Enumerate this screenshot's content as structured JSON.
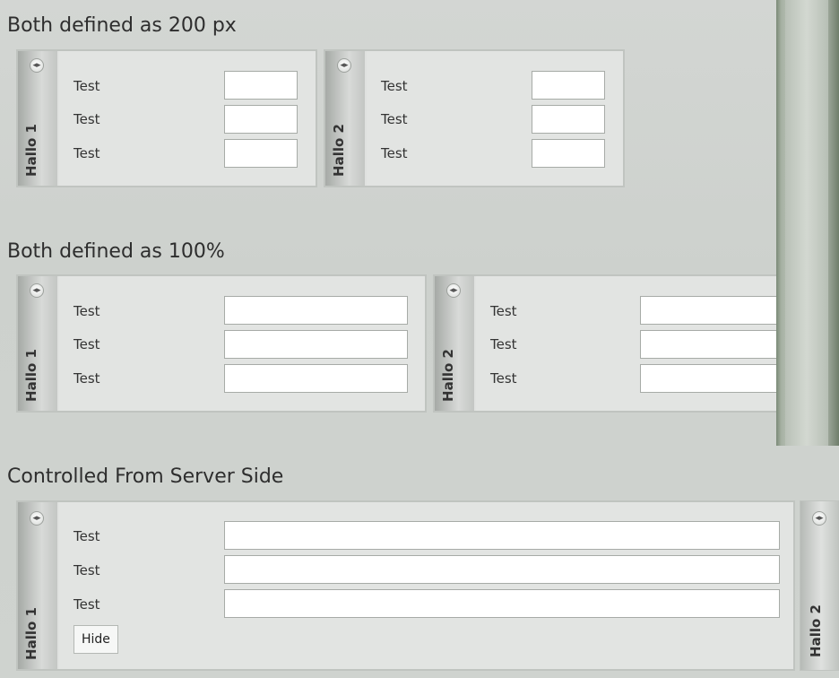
{
  "sections": [
    {
      "heading": "Both defined as 200 px",
      "panels": [
        {
          "title": "Hallo 1",
          "rows": [
            "Test",
            "Test",
            "Test"
          ],
          "toggle_icon": "collapse-toggle-icon"
        },
        {
          "title": "Hallo 2",
          "rows": [
            "Test",
            "Test",
            "Test"
          ],
          "toggle_icon": "collapse-toggle-icon"
        }
      ]
    },
    {
      "heading": "Both defined as 100%",
      "panels": [
        {
          "title": "Hallo 1",
          "rows": [
            "Test",
            "Test",
            "Test"
          ],
          "toggle_icon": "collapse-toggle-icon"
        },
        {
          "title": "Hallo 2",
          "rows": [
            "Test",
            "Test",
            "Test"
          ],
          "toggle_icon": "collapse-toggle-icon"
        }
      ]
    },
    {
      "heading": "Controlled From Server Side",
      "panels": [
        {
          "title": "Hallo 1",
          "rows": [
            "Test",
            "Test",
            "Test"
          ],
          "button": "Hide",
          "toggle_icon": "collapse-toggle-icon"
        },
        {
          "title": "Hallo 2",
          "toggle_icon": "collapse-toggle-icon"
        }
      ]
    }
  ],
  "toggle_glyph": "◂▸",
  "colors": {
    "background": "#cdd1cd",
    "panel": "#e2e4e2",
    "input_border": "#a7aba7",
    "divider": "#7b8a77"
  }
}
